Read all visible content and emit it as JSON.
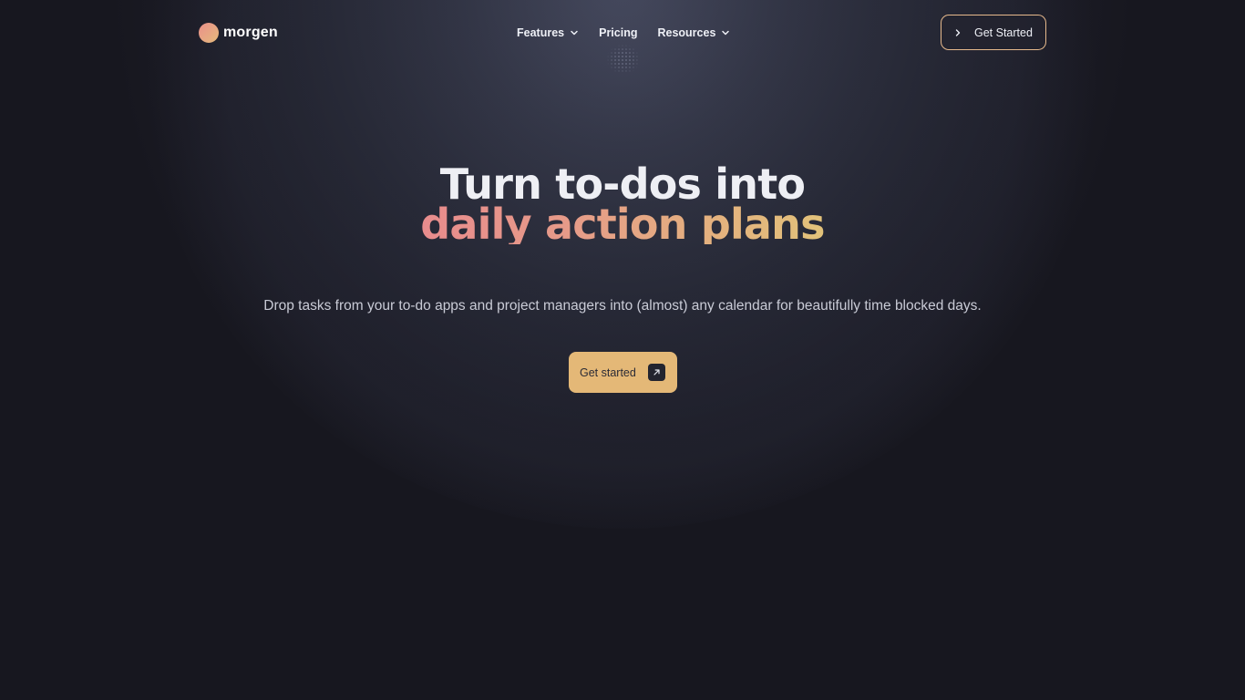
{
  "nav": {
    "logo_text": "morgen",
    "items": [
      {
        "label": "Features",
        "has_dropdown": true
      },
      {
        "label": "Pricing",
        "has_dropdown": false
      },
      {
        "label": "Resources",
        "has_dropdown": true
      }
    ],
    "cta_label": "Get Started"
  },
  "hero": {
    "title_line1": "Turn to-dos into",
    "title_line2": "daily action plans",
    "subtitle": "Drop tasks from your to-do apps and project managers into (almost) any calendar for beautifully time blocked days.",
    "cta_label": "Get started"
  },
  "icons": {
    "logo": "morgen-logo-icon",
    "dropdown": "chevron-down-icon",
    "cta_arrow": "chevron-right-icon",
    "primary_arrow": "arrow-up-right-icon"
  },
  "colors": {
    "background": "#17171f",
    "accent_gold": "#e4b877",
    "accent_pink": "#e88c8d",
    "outline_border": "#e6b98c",
    "text_light": "#eeeff4"
  }
}
